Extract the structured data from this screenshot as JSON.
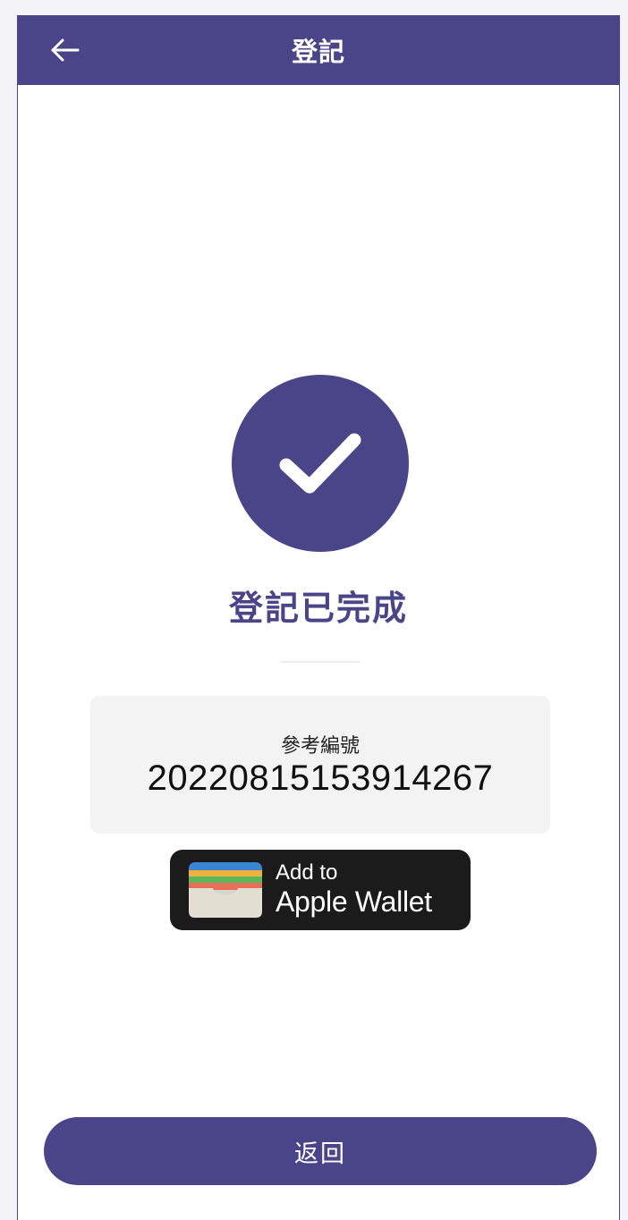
{
  "header": {
    "title": "登記",
    "back_icon": "arrow-left-icon"
  },
  "status": {
    "icon": "check-icon",
    "title": "登記已完成"
  },
  "reference": {
    "label": "參考編號",
    "number": "20220815153914267"
  },
  "wallet_button": {
    "line1": "Add to",
    "line2": "Apple Wallet",
    "icon": "wallet-icon"
  },
  "footer": {
    "return_label": "返回"
  },
  "colors": {
    "brand": "#4a4589",
    "background": "#ffffff",
    "panel": "#f3f3f4",
    "wallet_button": "#1b1b1b"
  }
}
